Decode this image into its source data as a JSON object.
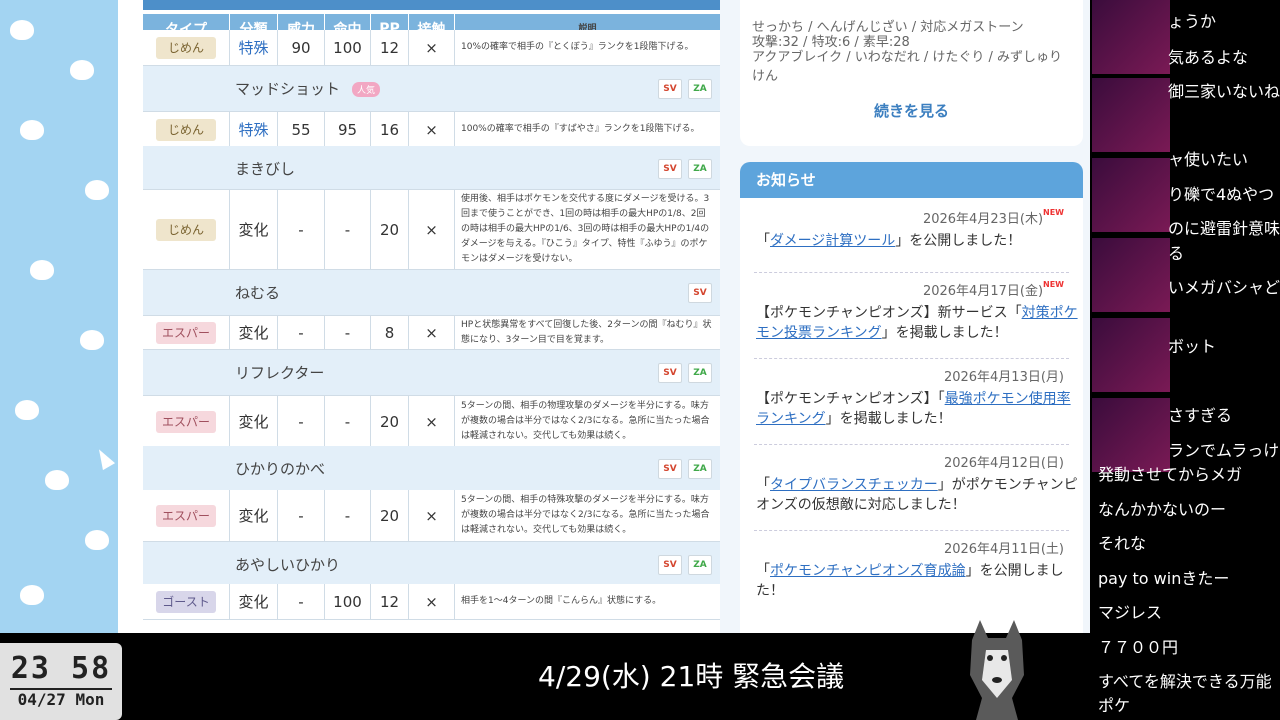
{
  "table": {
    "headers": [
      "タイプ",
      "分類",
      "威力",
      "命中",
      "PP",
      "接触",
      "説明"
    ],
    "rows": [
      {
        "kind": "data",
        "type": "じめん",
        "type_class": "t-jimen",
        "category": "特殊",
        "power": "90",
        "accuracy": "100",
        "pp": "12",
        "contact": "×",
        "desc": "10%の確率で相手の『とくぼう』ランクを1段階下げる。"
      },
      {
        "kind": "name",
        "name": "マッドショット",
        "badge": "人気",
        "tags": [
          "SV",
          "ZA"
        ]
      },
      {
        "kind": "data",
        "type": "じめん",
        "type_class": "t-jimen",
        "category": "特殊",
        "power": "55",
        "accuracy": "95",
        "pp": "16",
        "contact": "×",
        "desc": "100%の確率で相手の『すばやさ』ランクを1段階下げる。"
      },
      {
        "kind": "name",
        "name": "まきびし",
        "tags": [
          "SV",
          "ZA"
        ]
      },
      {
        "kind": "data",
        "type": "じめん",
        "type_class": "t-jimen",
        "category": "変化",
        "power": "-",
        "accuracy": "-",
        "pp": "20",
        "contact": "×",
        "desc": "使用後、相手はポケモンを交代する度にダメージを受ける。3回まで使うことができ、1回の時は相手の最大HPの1/8、2回の時は相手の最大HPの1/6、3回の時は相手の最大HPの1/4のダメージを与える。『ひこう』タイプ、特性『ふゆう』のポケモンはダメージを受けない。"
      },
      {
        "kind": "name",
        "name": "ねむる",
        "tags": [
          "SV"
        ]
      },
      {
        "kind": "data",
        "type": "エスパー",
        "type_class": "t-esper",
        "category": "変化",
        "power": "-",
        "accuracy": "-",
        "pp": "8",
        "contact": "×",
        "desc": "HPと状態異常をすべて回復した後、2ターンの間『ねむり』状態になり、3ターン目で目を覚ます。"
      },
      {
        "kind": "name",
        "name": "リフレクター",
        "tags": [
          "SV",
          "ZA"
        ]
      },
      {
        "kind": "data",
        "type": "エスパー",
        "type_class": "t-esper",
        "category": "変化",
        "power": "-",
        "accuracy": "-",
        "pp": "20",
        "contact": "×",
        "desc": "5ターンの間、相手の物理攻撃のダメージを半分にする。味方が複数の場合は半分ではなく2/3になる。急所に当たった場合は軽減されない。交代しても効果は続く。"
      },
      {
        "kind": "name",
        "name": "ひかりのかべ",
        "tags": [
          "SV",
          "ZA"
        ]
      },
      {
        "kind": "data",
        "type": "エスパー",
        "type_class": "t-esper",
        "category": "変化",
        "power": "-",
        "accuracy": "-",
        "pp": "20",
        "contact": "×",
        "desc": "5ターンの間、相手の特殊攻撃のダメージを半分にする。味方が複数の場合は半分ではなく2/3になる。急所に当たった場合は軽減されない。交代しても効果は続く。"
      },
      {
        "kind": "name",
        "name": "あやしいひかり",
        "tags": [
          "SV",
          "ZA"
        ]
      },
      {
        "kind": "data",
        "type": "ゴースト",
        "type_class": "t-ghost",
        "category": "変化",
        "power": "-",
        "accuracy": "100",
        "pp": "12",
        "contact": "×",
        "desc": "相手を1〜4ターンの間『こんらん』状態にする。"
      }
    ]
  },
  "sidebar": {
    "card_lines": [
      "せっかち / へんげんじざい / 対応メガストーン",
      "攻撃:32 / 特攻:6 / 素早:28",
      "アクアブレイク / いわなだれ / けたぐり / みずしゅりけん"
    ],
    "more_label": "続きを見る",
    "news_title": "お知らせ",
    "news": [
      {
        "date": "2026年4月23日(木)",
        "is_new": true,
        "pre": "「",
        "link": "ダメージ計算ツール",
        "post": "」を公開しました！"
      },
      {
        "date": "2026年4月17日(金)",
        "is_new": true,
        "pre": "【ポケモンチャンピオンズ】新サービス「",
        "link": "対策ポケモン投票ランキング",
        "post": "」を掲載しました！"
      },
      {
        "date": "2026年4月13日(月)",
        "is_new": false,
        "pre": "【ポケモンチャンピオンズ】「",
        "link": "最強ポケモン使用率ランキング",
        "post": "」を掲載しました！"
      },
      {
        "date": "2026年4月12日(日)",
        "is_new": false,
        "pre": "「",
        "link": "タイプバランスチェッカー",
        "post": "」がポケモンチャンピオンズの仮想敵に対応しました！"
      },
      {
        "date": "2026年4月11日(土)",
        "is_new": false,
        "pre": "「",
        "link": "ポケモンチャンピオンズ育成論",
        "post": "」を公開しました！"
      }
    ],
    "new_mark": "NEW"
  },
  "comments": [
    "ょうか",
    "気あるよな",
    "御三家いないね",
    "ャ使いたい",
    "り礫で4ぬやつ",
    "のに避雷針意味",
    "る",
    "いメガバシャど",
    "ボット",
    "さすぎる",
    "ランでムラっけ",
    "発動させてからメガ",
    "なんかかないのー",
    "それな",
    "pay to winきたー",
    "マジレス",
    "７７００円",
    "すべてを解決できる万能",
    "ポケ"
  ],
  "clock": {
    "time": "23 58",
    "date": "04/27 Mon"
  },
  "headline": "4/29(水) 21時 緊急会議"
}
